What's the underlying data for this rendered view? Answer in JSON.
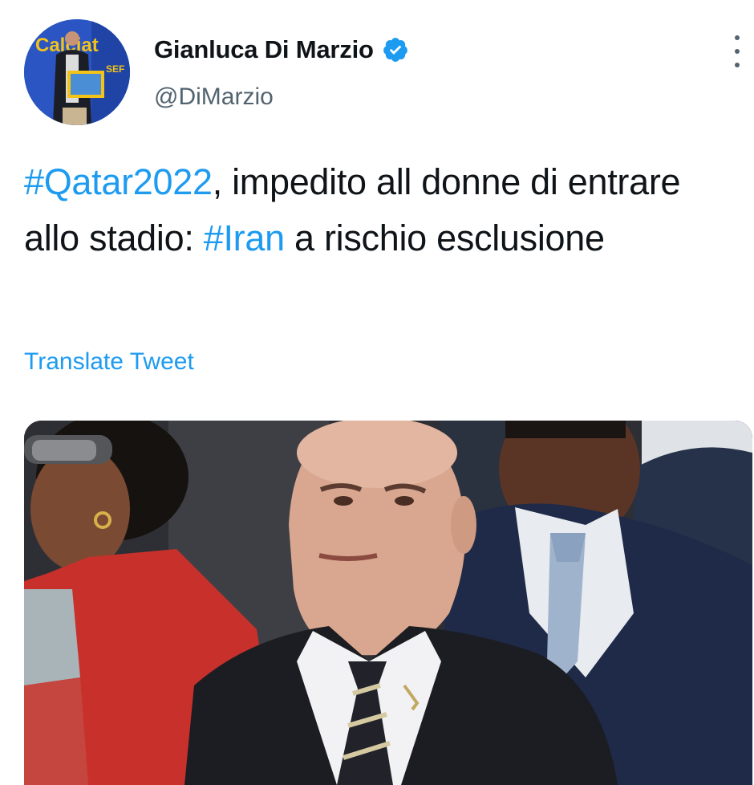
{
  "tweet": {
    "author": {
      "display_name": "Gianluca Di Marzio",
      "handle": "@DiMarzio",
      "verified": true,
      "avatar_text": "Calciat",
      "avatar_subtext": "SEF"
    },
    "text_segments": [
      {
        "text": "#Qatar2022",
        "type": "hashtag"
      },
      {
        "text": ", impedito all donne di entrare allo stadio: ",
        "type": "text"
      },
      {
        "text": "#Iran",
        "type": "hashtag"
      },
      {
        "text": " a rischio esclusione",
        "type": "text"
      }
    ],
    "translate_label": "Translate Tweet",
    "more_icon": "more-vertical-icon"
  },
  "colors": {
    "link": "#1d9bf0",
    "text": "#0f1419",
    "secondary": "#536471",
    "verified": "#1d9bf0"
  }
}
